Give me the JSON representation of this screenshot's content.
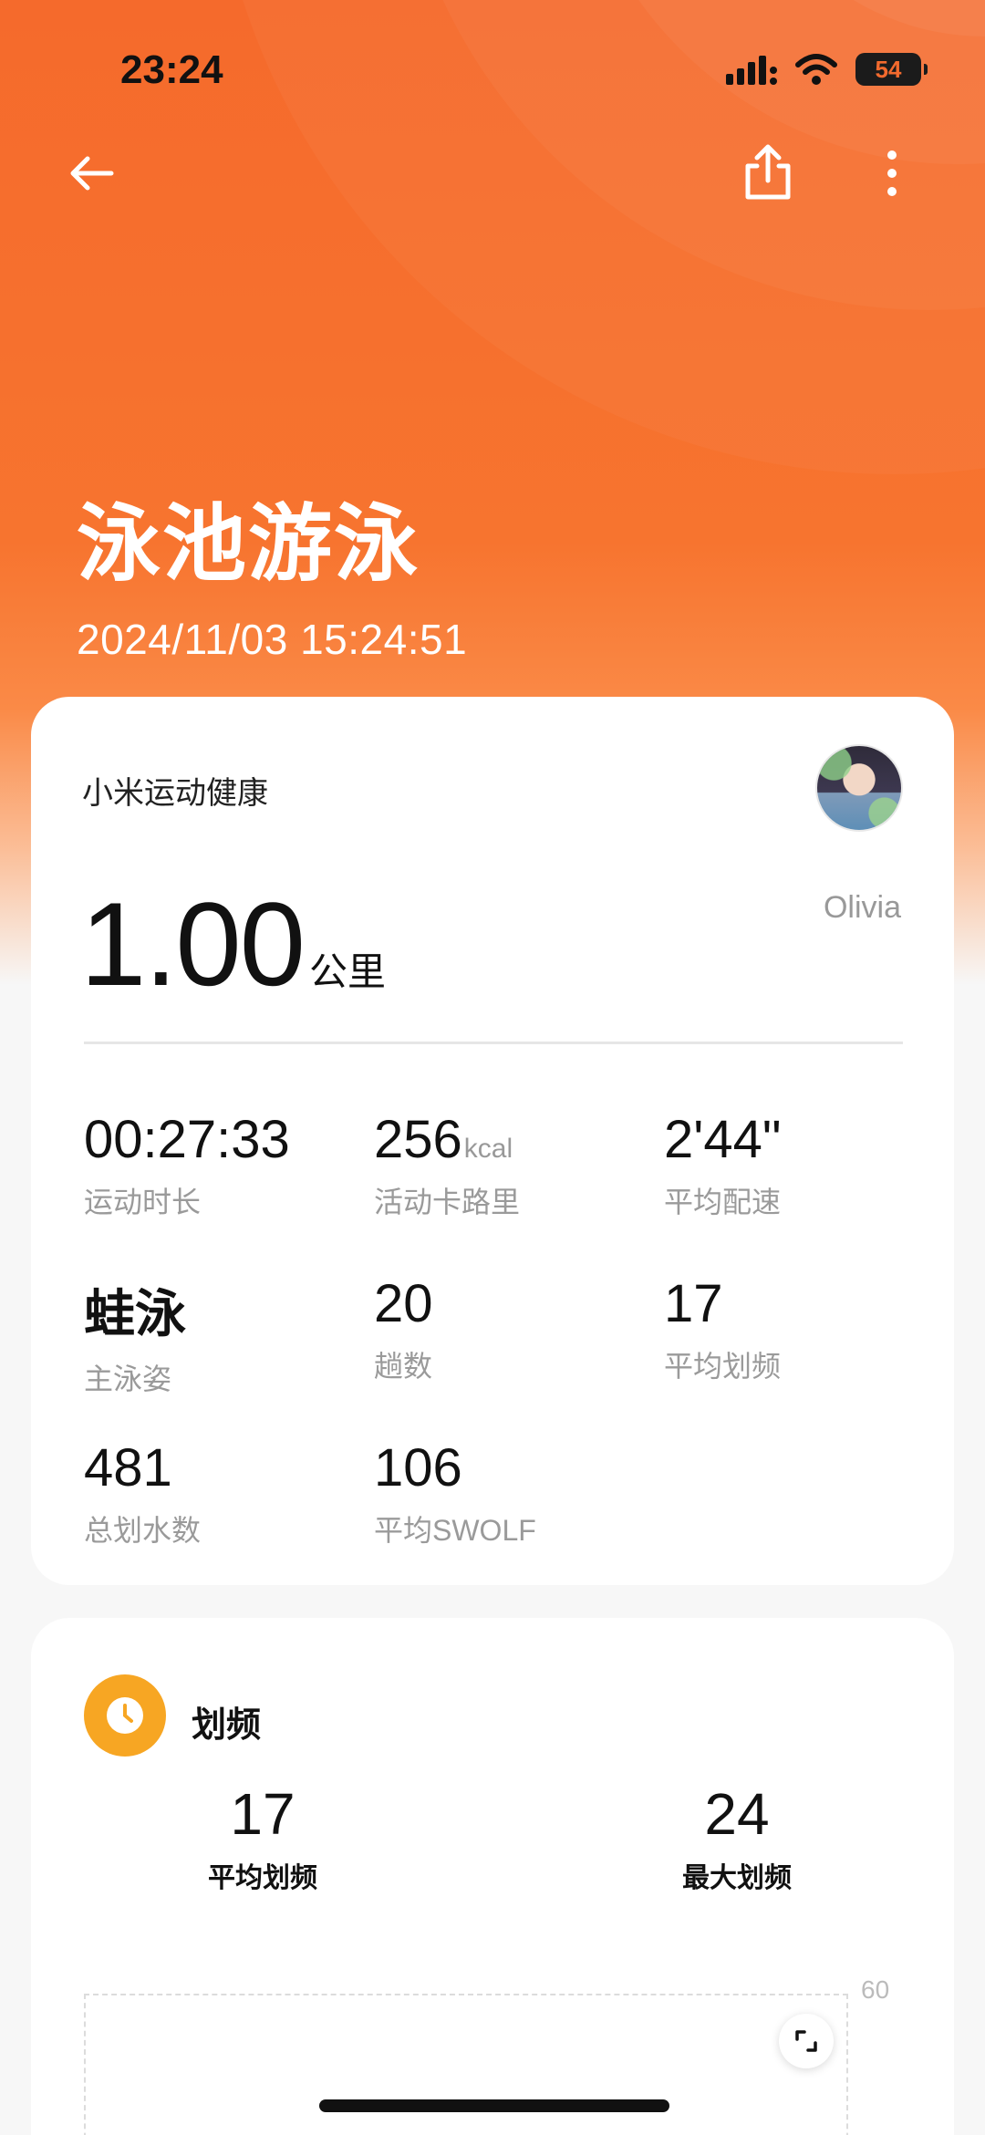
{
  "status_bar": {
    "time": "23:24",
    "battery": "54",
    "signal_icon": "cellular-signal-icon",
    "wifi_icon": "wifi-icon"
  },
  "nav": {
    "back_icon": "back-arrow-icon",
    "share_icon": "share-icon",
    "more_icon": "more-vertical-icon"
  },
  "workout": {
    "title": "泳池游泳",
    "datetime": "2024/11/03 15:24:51"
  },
  "summary": {
    "brand": "小米运动健康",
    "user_name": "Olivia",
    "distance_value": "1.00",
    "distance_unit": "公里",
    "stats": [
      {
        "value": "00:27:33",
        "unit": "",
        "label": "运动时长"
      },
      {
        "value": "256",
        "unit": "kcal",
        "label": "活动卡路里"
      },
      {
        "value": "2'44\"",
        "unit": "",
        "label": "平均配速"
      },
      {
        "value": "蛙泳",
        "unit": "",
        "label": "主泳姿"
      },
      {
        "value": "20",
        "unit": "",
        "label": "趟数"
      },
      {
        "value": "17",
        "unit": "",
        "label": "平均划频"
      },
      {
        "value": "481",
        "unit": "",
        "label": "总划水数"
      },
      {
        "value": "106",
        "unit": "",
        "label": "平均SWOLF"
      }
    ]
  },
  "stroke_rate": {
    "icon": "clock-icon",
    "title": "划频",
    "avg_value": "17",
    "avg_label": "平均划频",
    "max_value": "24",
    "max_label": "最大划频",
    "chart_axis_max": "60",
    "expand_icon": "expand-icon"
  },
  "colors": {
    "accent_orange": "#f56a2c",
    "icon_yellow": "#f7a623"
  }
}
